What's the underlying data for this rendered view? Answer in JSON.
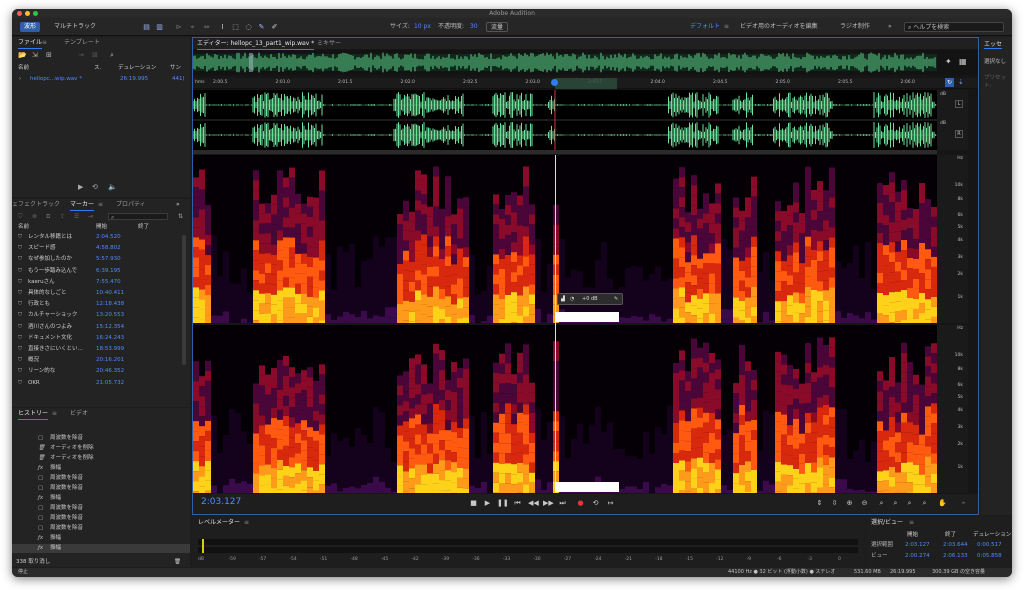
{
  "app": {
    "title": "Adobe Audition"
  },
  "toolbar": {
    "waveform_label": "波形",
    "multitrack_label": "マルチトラック",
    "size_label": "サイズ:",
    "size_value": "10 px",
    "opacity_label": "不透明度:",
    "opacity_value": "30",
    "flow_label": "流量",
    "workspace_default": "デフォルト",
    "workspace_video": "ビデオ用のオーディオを編集",
    "workspace_radio": "ラジオ制作",
    "search_placeholder": "ヘルプを検索"
  },
  "files_panel": {
    "tabs": [
      "ファイル",
      "テンプレート"
    ],
    "columns": {
      "name": "名前",
      "state": "ス.",
      "duration": "デュレーション",
      "sample": "サン"
    },
    "file": {
      "name": "hellopc...wip.wav *",
      "duration": "26:19.995",
      "sample": "441("
    }
  },
  "markers_panel": {
    "tabs": [
      "ェフェクトラック",
      "マーカー",
      "プロパティ"
    ],
    "columns": {
      "name": "名前",
      "start": "開始",
      "end": "終了"
    },
    "rows": [
      {
        "name": "レンタル移籍とは",
        "start": "2:04.520"
      },
      {
        "name": "スピード感",
        "start": "4:58.802"
      },
      {
        "name": "なぜ参加したのか",
        "start": "5:57.930"
      },
      {
        "name": "もう一歩踏み込んで",
        "start": "6:39.195"
      },
      {
        "name": "kaeruさん",
        "start": "7:55.470"
      },
      {
        "name": "具体的なしごと",
        "start": "10:40.411"
      },
      {
        "name": "行政とも",
        "start": "12:18.438"
      },
      {
        "name": "カルチャーショック",
        "start": "13:20.553"
      },
      {
        "name": "酒川さんのつよみ",
        "start": "15:12.354"
      },
      {
        "name": "ドキュメント文化",
        "start": "16:24.243"
      },
      {
        "name": "直接きさにいくとい...",
        "start": "18:53.999"
      },
      {
        "name": "概況",
        "start": "20:16.201"
      },
      {
        "name": "リーン的な",
        "start": "20:46.352"
      },
      {
        "name": "OKR",
        "start": "21:05.732"
      }
    ]
  },
  "history_panel": {
    "tabs": [
      "ヒストリー",
      "ビデオ"
    ],
    "items": [
      {
        "icon": "history-icon",
        "label": "周波数を除音"
      },
      {
        "icon": "trash-icon",
        "label": "オーディオを削除"
      },
      {
        "icon": "trash-icon",
        "label": "オーディオを削除"
      },
      {
        "icon": "fx-icon",
        "label": "振幅"
      },
      {
        "icon": "history-icon",
        "label": "周波数を除音"
      },
      {
        "icon": "history-icon",
        "label": "周波数を除音"
      },
      {
        "icon": "fx-icon",
        "label": "振幅"
      },
      {
        "icon": "history-icon",
        "label": "周波数を除音"
      },
      {
        "icon": "history-icon",
        "label": "周波数を除音"
      },
      {
        "icon": "history-icon",
        "label": "周波数を除音"
      },
      {
        "icon": "fx-icon",
        "label": "振幅"
      },
      {
        "icon": "fx-icon",
        "label": "振幅"
      }
    ],
    "undo_count": "338 取り消し"
  },
  "editor": {
    "tab_label": "エディター: hellopc_13_part1_wip.wav *",
    "mixer_label": "ミキサー",
    "ruler_unit": "hms",
    "ruler_ticks": [
      "2:00.5",
      "2:01.0",
      "2:01.5",
      "2:02.0",
      "2:02.5",
      "2:03.0",
      "2:03.5",
      "2:04.0",
      "2:04.5",
      "2:05.0",
      "2:05.5",
      "2:06.0"
    ],
    "db_label": "dB",
    "hz_label": "Hz",
    "freq_ticks": [
      "10k",
      "8k",
      "6k",
      "5k",
      "4k",
      "3k",
      "2k",
      "1k"
    ],
    "hud_gain": "+0 dB",
    "timecode": "2:03.127"
  },
  "effects_panel": {
    "title": "エッセ",
    "selection": "選択なし",
    "preset": "プリセット:"
  },
  "level_meter": {
    "title": "レベルメーター",
    "scale": [
      "dB",
      "-59",
      "-57",
      "-54",
      "-51",
      "-48",
      "-45",
      "-42",
      "-39",
      "-36",
      "-33",
      "-30",
      "-27",
      "-24",
      "-21",
      "-18",
      "-15",
      "-12",
      "-9",
      "-6",
      "-3",
      "0"
    ]
  },
  "selection_view": {
    "title": "選択/ビュー",
    "col_start": "開始",
    "col_end": "終了",
    "col_duration": "デュレーション",
    "selection_label": "選択範囲",
    "sel_start": "2:03.127",
    "sel_end": "2:03.644",
    "sel_duration": "0:00.517",
    "view_label": "ビュー",
    "view_start": "2:00.274",
    "view_end": "2:06.133",
    "view_duration": "0:05.858"
  },
  "status_bar": {
    "state": "停止",
    "format": "44100 Hz ● 32 ビット (浮動小数) ● ステレオ",
    "size": "531.60 MB",
    "duration": "26:19.995",
    "free": "300.39 GB の空き容量"
  },
  "colors": {
    "accent": "#2f7df6",
    "waveform": "#6ee29a",
    "timecode": "#4a8fff"
  }
}
